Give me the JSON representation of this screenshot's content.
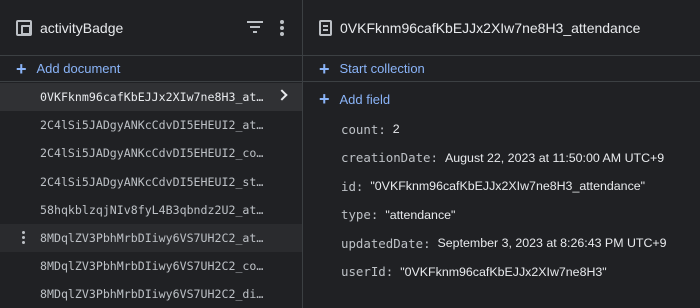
{
  "collection": {
    "title": "activityBadge",
    "icon": "collection-icon",
    "add_document_label": "Add document",
    "documents": [
      {
        "id": "0VKFknm96cafKbEJJx2XIw7ne8H3_at…",
        "selected": true
      },
      {
        "id": "2C4lSi5JADgyANKcCdvDI5EHEUI2_at…",
        "selected": false
      },
      {
        "id": "2C4lSi5JADgyANKcCdvDI5EHEUI2_co…",
        "selected": false
      },
      {
        "id": "2C4lSi5JADgyANKcCdvDI5EHEUI2_st…",
        "selected": false
      },
      {
        "id": "58hqkblzqjNIv8fyL4B3qbndz2U2_at…",
        "selected": false
      },
      {
        "id": "8MDqlZV3PbhMrbDIiwy6VS7UH2C2_at…",
        "selected": false,
        "hovered": true
      },
      {
        "id": "8MDqlZV3PbhMrbDIiwy6VS7UH2C2_co…",
        "selected": false
      },
      {
        "id": "8MDqlZV3PbhMrbDIiwy6VS7UH2C2_di…",
        "selected": false
      }
    ]
  },
  "document": {
    "title": "0VKFknm96cafKbEJJx2XIw7ne8H3_attendance",
    "icon": "document-icon",
    "start_collection_label": "Start collection",
    "add_field_label": "Add field",
    "fields": [
      {
        "key": "count",
        "value": "2"
      },
      {
        "key": "creationDate",
        "value": "August 22, 2023 at 11:50:00 AM UTC+9"
      },
      {
        "key": "id",
        "value": "\"0VKFknm96cafKbEJJx2XIw7ne8H3_attendance\""
      },
      {
        "key": "type",
        "value": "\"attendance\""
      },
      {
        "key": "updatedDate",
        "value": "September 3, 2023 at 8:26:43 PM UTC+9"
      },
      {
        "key": "userId",
        "value": "\"0VKFknm96cafKbEJJx2XIw7ne8H3\""
      }
    ]
  },
  "colors": {
    "background": "#202124",
    "accent": "#8ab4f8",
    "selected_row": "#303134",
    "divider": "#3c4043"
  }
}
